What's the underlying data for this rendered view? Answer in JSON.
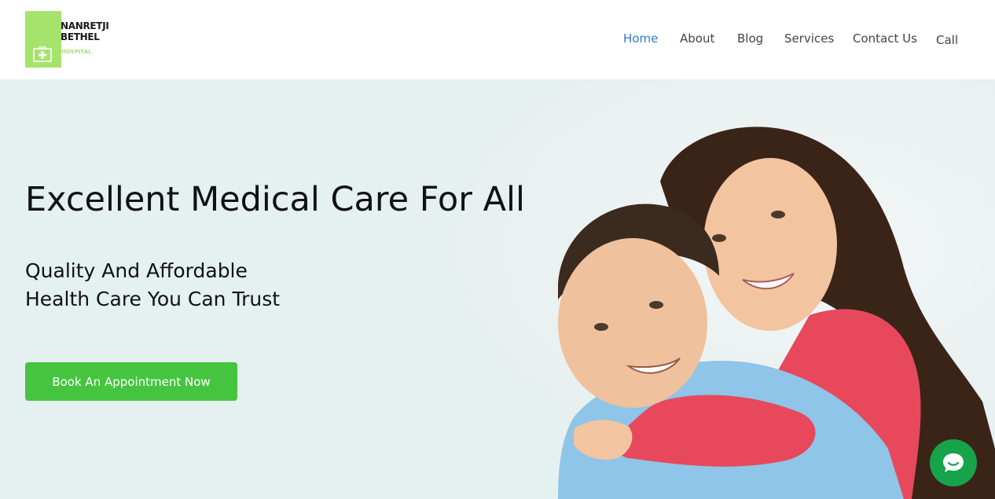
{
  "logo": {
    "line1": "NANRETJI",
    "line2": "BETHEL",
    "line3": "HOSPITAL",
    "icon": "medical-kit-icon"
  },
  "nav": {
    "items": [
      {
        "label": "Home",
        "active": true
      },
      {
        "label": "About",
        "active": false
      },
      {
        "label": "Blog",
        "active": false
      },
      {
        "label": "Services",
        "active": false
      },
      {
        "label": "Contact Us",
        "active": false
      },
      {
        "label": "Call",
        "active": false
      }
    ]
  },
  "hero": {
    "title": "Excellent Medical Care For All",
    "subtitle_line1": "Quality And Affordable",
    "subtitle_line2": "Health Care You Can Trust",
    "cta_label": "Book An Appointment Now",
    "image": "smiling-couple-photo"
  },
  "chat": {
    "icon": "chat-bubble-icon"
  },
  "colors": {
    "accent_nav": "#2e7bcf",
    "cta_green": "#45c53f",
    "logo_green": "#a6e36c",
    "hero_bg": "#e5f0f0",
    "chat_green": "#16a34a"
  }
}
